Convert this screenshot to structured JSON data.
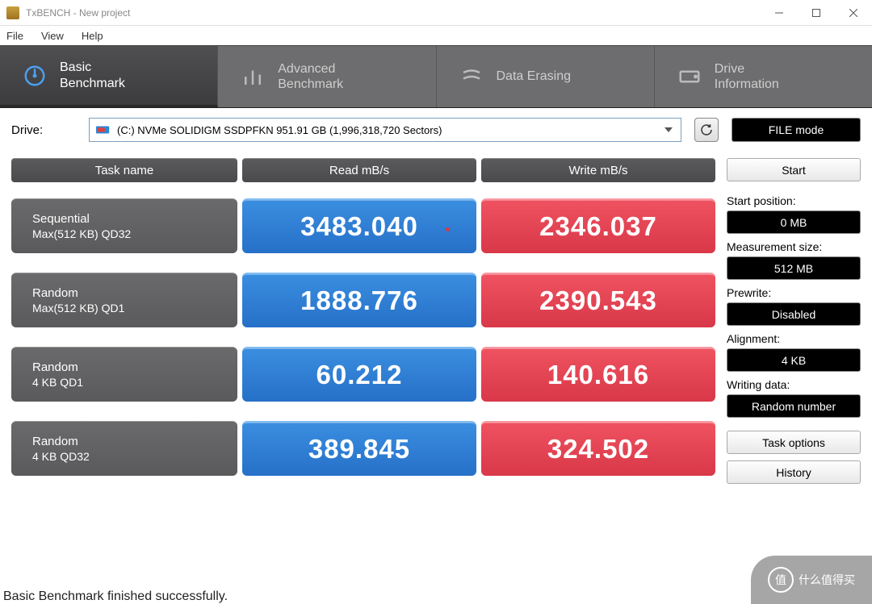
{
  "window": {
    "title": "TxBENCH - New project"
  },
  "menu": {
    "file": "File",
    "view": "View",
    "help": "Help"
  },
  "tabs": {
    "basic": "Basic\nBenchmark",
    "advanced": "Advanced\nBenchmark",
    "erase": "Data Erasing",
    "info": "Drive\nInformation"
  },
  "drive": {
    "label": "Drive:",
    "value": "(C:) NVMe SOLIDIGM SSDPFKN  951.91 GB (1,996,318,720 Sectors)"
  },
  "filemode": "FILE mode",
  "headers": {
    "task": "Task name",
    "read": "Read mB/s",
    "write": "Write mB/s"
  },
  "rows": [
    {
      "name1": "Sequential",
      "name2": "Max(512 KB) QD32",
      "read": "3483.040",
      "write": "2346.037"
    },
    {
      "name1": "Random",
      "name2": "Max(512 KB) QD1",
      "read": "1888.776",
      "write": "2390.543"
    },
    {
      "name1": "Random",
      "name2": "4 KB QD1",
      "read": "60.212",
      "write": "140.616"
    },
    {
      "name1": "Random",
      "name2": "4 KB QD32",
      "read": "389.845",
      "write": "324.502"
    }
  ],
  "sidebar": {
    "start": "Start",
    "startpos_lbl": "Start position:",
    "startpos_val": "0 MB",
    "measize_lbl": "Measurement size:",
    "measize_val": "512 MB",
    "prewrite_lbl": "Prewrite:",
    "prewrite_val": "Disabled",
    "align_lbl": "Alignment:",
    "align_val": "4 KB",
    "wdata_lbl": "Writing data:",
    "wdata_val": "Random number",
    "taskopt": "Task options",
    "history": "History"
  },
  "status": "Basic Benchmark finished successfully.",
  "watermark": "什么值得买"
}
